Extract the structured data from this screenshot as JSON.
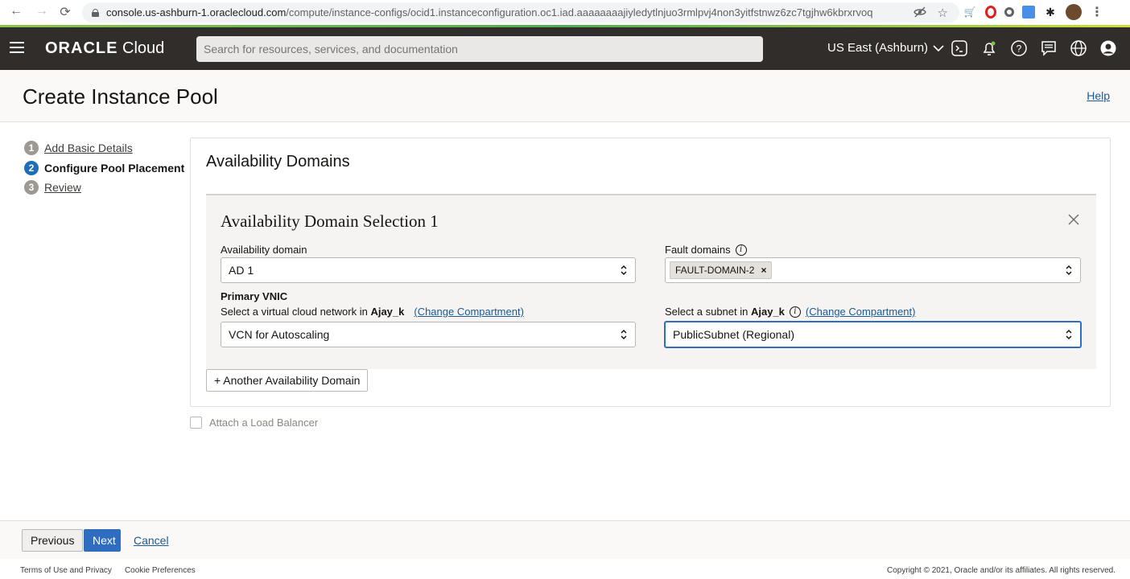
{
  "browser": {
    "url_host": "console.us-ashburn-1.oraclecloud.com",
    "url_path": "/compute/instance-configs/ocid1.instanceconfiguration.oc1.iad.aaaaaaaajiyledytlnjuo3rmlpvj4non3yitfstnwz6zc7tgjhw6kbrxrvoq"
  },
  "header": {
    "brand_oracle": "ORACLE",
    "brand_cloud": "Cloud",
    "search_placeholder": "Search for resources, services, and documentation",
    "region": "US East (Ashburn)"
  },
  "page": {
    "title": "Create Instance Pool",
    "help": "Help"
  },
  "steps": [
    {
      "num": "1",
      "label": "Add Basic Details"
    },
    {
      "num": "2",
      "label": "Configure Pool Placement"
    },
    {
      "num": "3",
      "label": "Review"
    }
  ],
  "panel": {
    "title": "Availability Domains",
    "selection_title": "Availability Domain Selection 1",
    "ad_label": "Availability domain",
    "ad_value": "AD 1",
    "fault_label": "Fault domains",
    "fault_chip": "FAULT-DOMAIN-2",
    "fault_chip_remove": "×",
    "primary_vnic": "Primary VNIC",
    "vcn_label_prefix": "Select a virtual cloud network in",
    "vcn_label_compartment": "Ajay_k",
    "vcn_change": "(Change Compartment)",
    "vcn_value": "VCN for Autoscaling",
    "subnet_label_prefix": "Select a subnet in",
    "subnet_label_compartment": "Ajay_k",
    "subnet_change": "(Change Compartment)",
    "subnet_value": "PublicSubnet (Regional)",
    "another_ad": "+ Another Availability Domain"
  },
  "load_balancer": {
    "label": "Attach a Load Balancer",
    "checked": false
  },
  "actions": {
    "previous": "Previous",
    "next": "Next",
    "cancel": "Cancel"
  },
  "footer": {
    "terms": "Terms of Use and Privacy",
    "cookies": "Cookie Preferences",
    "copyright": "Copyright © 2021, Oracle and/or its affiliates. All rights reserved."
  },
  "colors": {
    "header_bg": "#312d2a",
    "primary_blue": "#2e6dbf",
    "link": "#1a5a96"
  }
}
